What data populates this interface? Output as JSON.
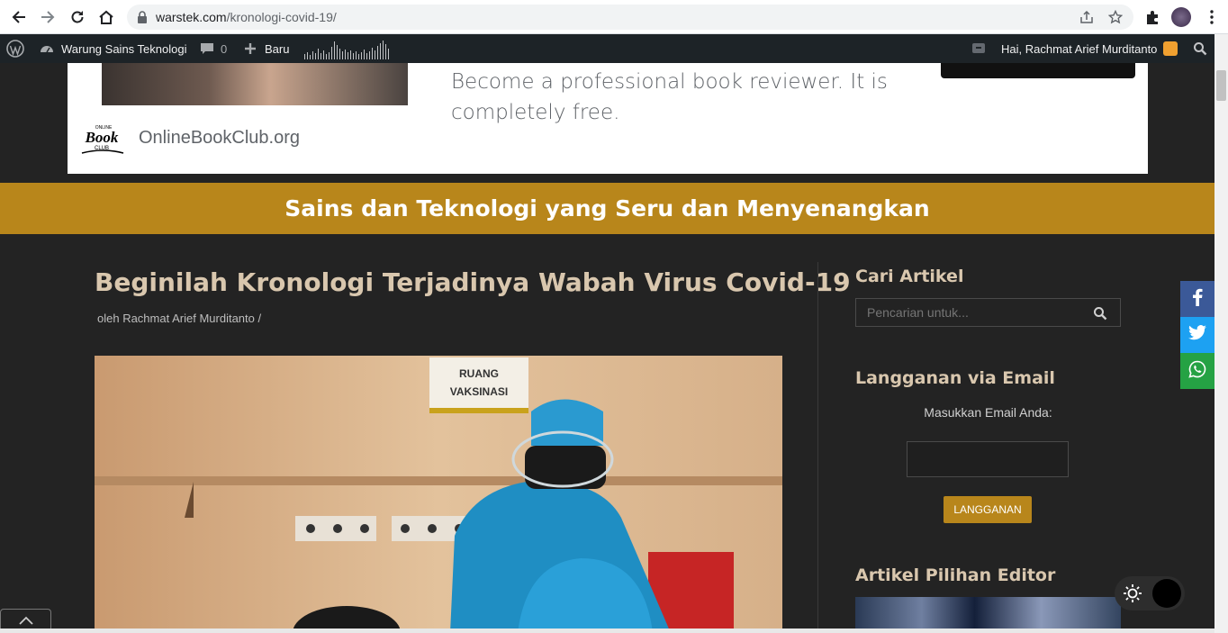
{
  "browser": {
    "url_domain": "warstek.com",
    "url_path": "/kronologi-covid-19/"
  },
  "admin_bar": {
    "site_name": "Warung Sains Teknologi",
    "comments_count": "0",
    "new_label": "Baru",
    "greeting": "Hai, Rachmat Arief Murditanto"
  },
  "ad": {
    "tagline": "Become a professional book reviewer. It is completely free.",
    "site": "OnlineBookClub.org",
    "logo_top": "ONLINE",
    "logo_main": "Book",
    "logo_bottom": "CLUB"
  },
  "banner": {
    "text": "Sains dan Teknologi yang Seru dan Menyenangkan"
  },
  "article": {
    "title": "Beginilah Kronologi Terjadinya Wabah Virus Covid-19",
    "byline": "oleh Rachmat Arief Murditanto  /",
    "photo_sign_line1": "RUANG",
    "photo_sign_line2": "VAKSINASI"
  },
  "sidebar": {
    "search_heading": "Cari Artikel",
    "search_placeholder": "Pencarian untuk...",
    "email_heading": "Langganan via Email",
    "email_label": "Masukkan Email Anda:",
    "subscribe_label": "LANGGANAN",
    "editor_heading": "Artikel Pilihan Editor"
  },
  "social": [
    {
      "icon": "facebook-icon",
      "color": "#3b5998"
    },
    {
      "icon": "twitter-icon",
      "color": "#1da1f2"
    },
    {
      "icon": "whatsapp-icon",
      "color": "#25a244"
    }
  ],
  "colors": {
    "accent": "#b8861b",
    "background": "#232323",
    "heading": "#d9c7ae"
  }
}
